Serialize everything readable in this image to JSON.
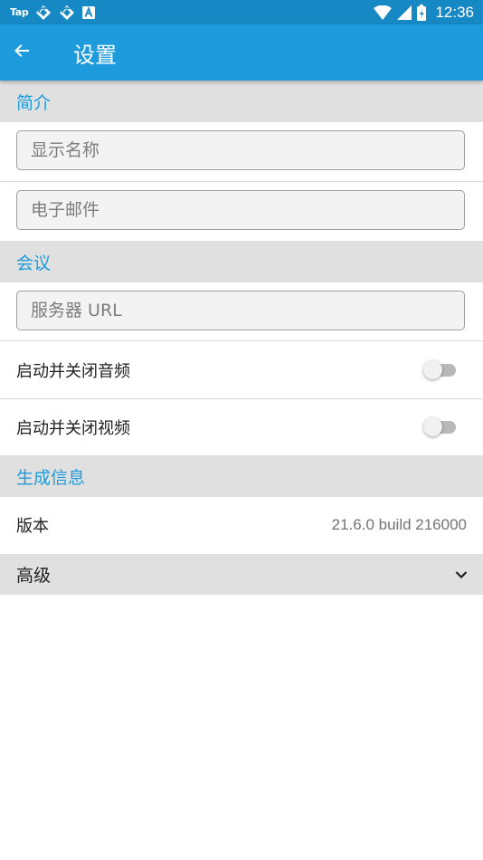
{
  "status_bar": {
    "carrier": "Tap",
    "time": "12:36",
    "icons": [
      "tap-app-icon",
      "sync-icon",
      "sync-icon",
      "a-app-icon",
      "wifi-icon",
      "signal-icon",
      "battery-icon"
    ]
  },
  "app_bar": {
    "back_icon": "arrow-back-icon",
    "title": "设置"
  },
  "sections": {
    "profile": {
      "title": "简介"
    },
    "conference": {
      "title": "会议"
    },
    "build": {
      "title": "生成信息"
    }
  },
  "fields": {
    "display_name": {
      "placeholder": "显示名称",
      "value": ""
    },
    "email": {
      "placeholder": "电子邮件",
      "value": ""
    },
    "server_url": {
      "placeholder": "服务器 URL",
      "value": ""
    }
  },
  "toggles": {
    "audio_muted": {
      "label": "启动并关闭音频",
      "on": false
    },
    "video_muted": {
      "label": "启动并关闭视频",
      "on": false
    }
  },
  "version": {
    "label": "版本",
    "value": "21.6.0 build 216000"
  },
  "advanced": {
    "label": "高级",
    "icon": "chevron-down-icon"
  },
  "colors": {
    "status_bar": "#1689c4",
    "app_bar": "#1d9bdc",
    "accent": "#1d9bdc",
    "section_bg": "#e0e0e0"
  }
}
